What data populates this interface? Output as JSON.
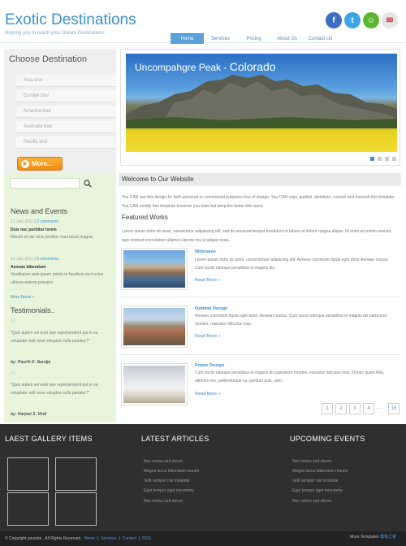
{
  "header": {
    "title": "Exotic Destinations",
    "tagline": "Helping you to reach your Dream Destinations"
  },
  "nav": [
    "Home",
    "Services",
    "Pricing",
    "About Us",
    "Contact Us"
  ],
  "sidebar": {
    "heading": "Choose Destination",
    "tours": [
      "Asia tour",
      "Europe tour",
      "America tour",
      "Australia tour",
      "Pacific tour"
    ],
    "more_label": "More...",
    "news_heading": "News and Events",
    "news": [
      {
        "date": "12 July 2011",
        "comments": "2 comments",
        "title": "Duis nec porttitor lorem",
        "body": "Mauris et nisi uma porttitor risus lacus magna."
      },
      {
        "date": "13 July 2011",
        "comments": "5 comments",
        "title": "Aenean bibendum",
        "body": "Vestibulum ante ipsum primis in faucibus orci luctus ultrices antena posuere."
      }
    ],
    "more_news": "More News »",
    "testimonials_heading": "Testimonials..",
    "testimonials": [
      {
        "quote": "\"Quis autem vel eum iure reprehenderit qui in ea voluptate velit esse voluptas nulla pariatur?\"",
        "author": "by: Paurth K. Nandja"
      },
      {
        "quote": "\"Quis autem vel eum iure reprehenderit qui in ea voluptate velit esse voluptas nulla pariatur?\"",
        "author": "by: Harjeet S. Virdi"
      }
    ]
  },
  "slider": {
    "caption_a": "Uncompahgre Peak - ",
    "caption_b": "Colorado"
  },
  "main": {
    "welcome_heading": "Welcome to Our Website",
    "welcome_text": "You CAN use this design for both personal or commercial purposes free of charge. You CAN copy, publish, distribute, convert and transmit this template. You CAN modify this template however you want but keep the footer link same.",
    "featured_heading": "Featured Works",
    "featured_text": "Lorem ipsum dolor sit amet, consectetur adipisicing elit, sed do eiusmod tempor incididunt ut labore et dolore magna aliqua. Ut enim ad minim veniam, quis nostrud exercitation ullamco laboris nisi ut aliquip exea.",
    "works": [
      {
        "title": "Webname",
        "desc": "Lorem ipsum dolor sit amet, consectetuer adipiscing elit. Aenean commodo ligula eget dolor Aenean massa. Cum sociis natoque penatibus et magnis dis.",
        "read_more": "Read More »"
      },
      {
        "title": "Optimal Design",
        "desc": "Aenean commodo ligula eget dolor. Aenean massa. Cum sociis natoque penatibus et magnis dis parturient montes, nascetur ridiculus mus.",
        "read_more": "Read More »"
      },
      {
        "title": "Power Design",
        "desc": "Cum sociis natoque penatibus et magnis dis parturient montes, nascetur ridiculus mus. Donec quam felis, ultricies nec, pellentesque eu, pretium quis, sem.",
        "read_more": "Read More »"
      }
    ],
    "pages": [
      "1",
      "2",
      "3",
      "4",
      "...",
      "15"
    ]
  },
  "footer": {
    "gallery_heading": "LAEST GALLERY ITEMS",
    "articles_heading": "LATEST ARTICLES",
    "events_heading": "UPCOMING EVENTS",
    "articles": [
      "Nec metus sed donec",
      "Magna lacus bibendum mauris",
      "Velit semper nisi molestie",
      "Eget tempor eget nonummy",
      "Nec metus sed donec"
    ],
    "events": [
      "Nec metus sed donec",
      "Magna lacus bibendum mauris",
      "Velit semper nisi molestie",
      "Eget tempor eget nonummy",
      "Nec metus sed donec"
    ],
    "copyright": "© Copyright yoursite . All Rights Reserved.",
    "links": [
      "Home",
      "Services",
      "Contact",
      "RSS"
    ],
    "more_templates": "More Templates",
    "more_templates_link": "模板之家"
  },
  "colors": {
    "accent": "#3b8fd4",
    "orange": "#f08a10",
    "green_panel": "#e8f5dc",
    "footer": "#2f2f2f"
  }
}
